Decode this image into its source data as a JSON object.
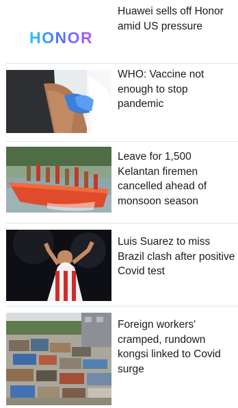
{
  "feed": {
    "items": [
      {
        "headline": "Huawei sells off Honor amid US pressure",
        "image": "honor-logo",
        "logo_text": "HONOR"
      },
      {
        "headline": "WHO: Vaccine not enough to stop pandemic",
        "image": "vaccine-injection-photo"
      },
      {
        "headline": "Leave for 1,500 Kelantan firemen cancelled ahead of monsoon season",
        "image": "firemen-boat-photo"
      },
      {
        "headline": "Luis Suarez to miss Brazil clash after positive Covid test",
        "image": "footballer-photo"
      },
      {
        "headline": "Foreign workers' cramped, rundown kongsi linked to Covid surge",
        "image": "kongsi-settlement-photo"
      }
    ]
  }
}
